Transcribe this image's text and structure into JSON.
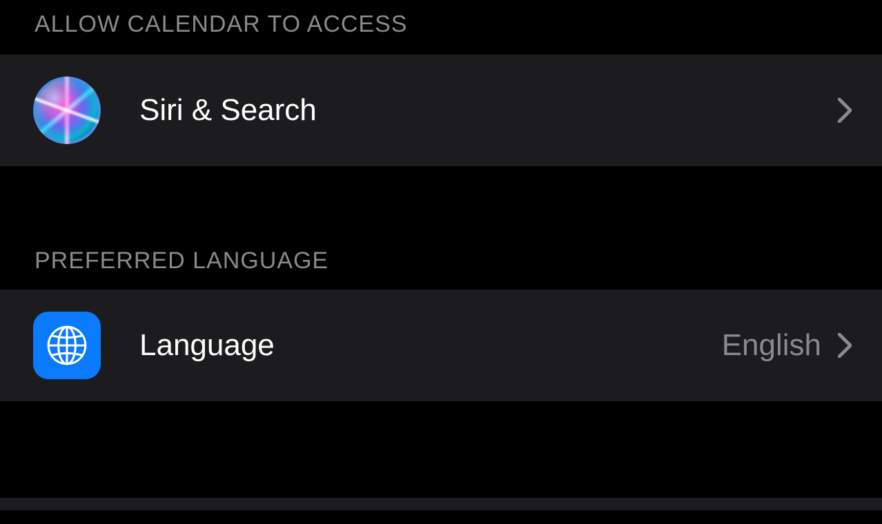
{
  "sections": {
    "access": {
      "header": "ALLOW CALENDAR TO ACCESS",
      "rows": {
        "siri_search": {
          "label": "Siri & Search",
          "icon": "siri-icon"
        }
      }
    },
    "language": {
      "header": "PREFERRED LANGUAGE",
      "rows": {
        "language": {
          "label": "Language",
          "value": "English",
          "icon": "globe-icon"
        }
      }
    }
  },
  "colors": {
    "bg": "#000000",
    "cell_bg": "#1c1c1e",
    "text_primary": "#ffffff",
    "text_secondary": "#8a8a8e",
    "accent_blue": "#0a7aff"
  }
}
